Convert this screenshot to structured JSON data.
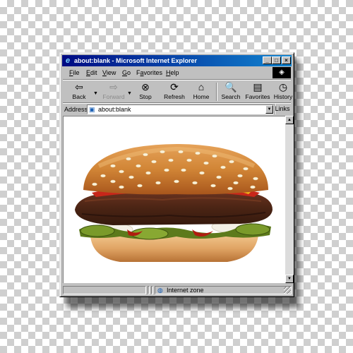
{
  "window": {
    "title": "about:blank - Microsoft Internet Explorer",
    "title_icon": "ie-e-icon",
    "controls": [
      "minimize-icon",
      "maximize-icon",
      "close-icon"
    ]
  },
  "menu": {
    "items": [
      {
        "key": "F",
        "rest": "ile"
      },
      {
        "key": "E",
        "rest": "dit"
      },
      {
        "key": "V",
        "rest": "iew"
      },
      {
        "key": "G",
        "rest": "o"
      },
      {
        "key": "",
        "pre": "F",
        "u": "a",
        "post": "vorites"
      },
      {
        "key": "H",
        "rest": "elp"
      }
    ]
  },
  "toolbar": {
    "back": "Back",
    "forward": "Forward",
    "stop": "Stop",
    "refresh": "Refresh",
    "home": "Home",
    "search": "Search",
    "favorites": "Favorites",
    "history": "History"
  },
  "address": {
    "label": "Address",
    "value": "about:blank",
    "links": "Links"
  },
  "status": {
    "zone": "Internet zone"
  },
  "colors": {
    "title_start": "#000a83",
    "title_end": "#1084d0",
    "chrome": "#c0c0c0"
  },
  "content": {
    "image": "cheeseburger"
  }
}
